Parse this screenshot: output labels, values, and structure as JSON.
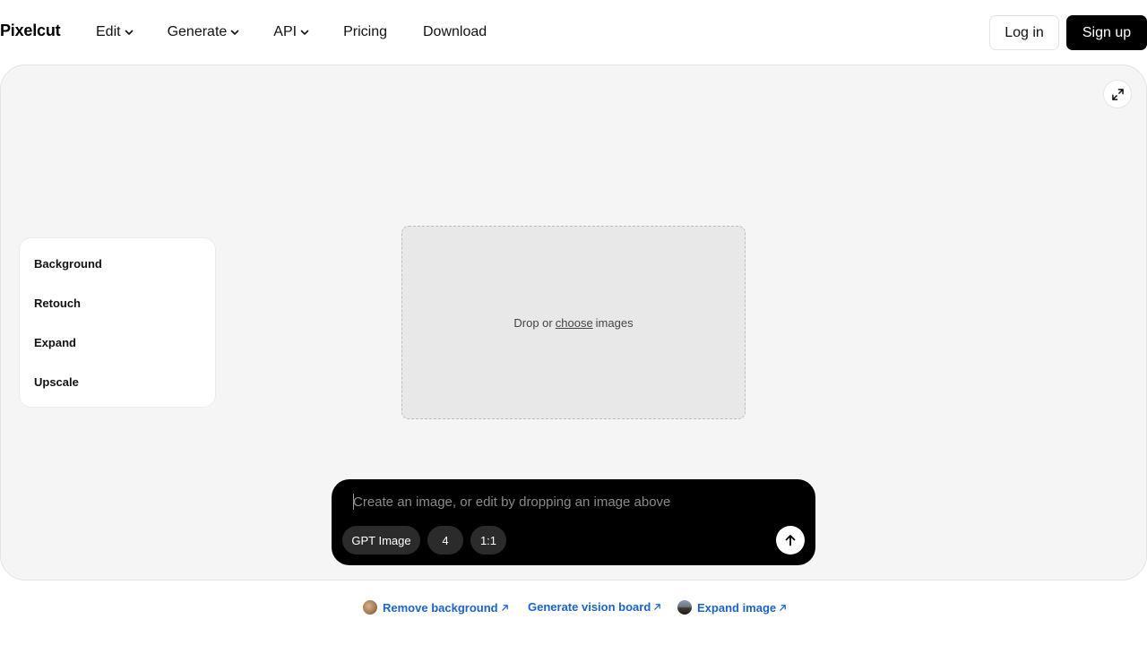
{
  "header": {
    "logo": "Pixelcut",
    "nav": [
      {
        "label": "Edit",
        "has_dropdown": true
      },
      {
        "label": "Generate",
        "has_dropdown": true
      },
      {
        "label": "API",
        "has_dropdown": true
      },
      {
        "label": "Pricing",
        "has_dropdown": false
      },
      {
        "label": "Download",
        "has_dropdown": false
      }
    ],
    "login_label": "Log in",
    "signup_label": "Sign up"
  },
  "side_panel": {
    "items": [
      {
        "label": "Background"
      },
      {
        "label": "Retouch"
      },
      {
        "label": "Expand"
      },
      {
        "label": "Upscale"
      }
    ]
  },
  "dropzone": {
    "text_before": "Drop or",
    "link_text": "choose",
    "text_after": "images"
  },
  "prompt": {
    "placeholder": "Create an image, or edit by dropping an image above",
    "value": "",
    "model_chip": "GPT Image",
    "count_chip": "4",
    "ratio_chip": "1:1"
  },
  "footer_links": [
    {
      "label": "Remove background",
      "icon": "thumbnail-portrait"
    },
    {
      "label": "Generate vision board",
      "icon": ""
    },
    {
      "label": "Expand image",
      "icon": "thumbnail-landscape"
    }
  ],
  "colors": {
    "primary": "#000000",
    "canvas_bg": "#f5f5f5",
    "link": "#1a63c8"
  }
}
